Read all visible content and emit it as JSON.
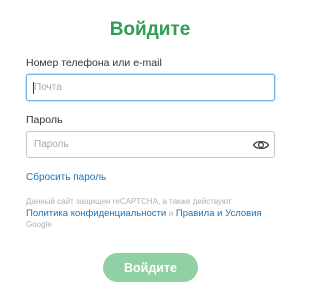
{
  "title": "Войдите",
  "login": {
    "label": "Номер телефона или e-mail",
    "placeholder": "Почта",
    "value": ""
  },
  "password": {
    "label": "Пароль",
    "placeholder": "Пароль",
    "value": "",
    "toggle_icon": "eye-icon"
  },
  "forgot_link": "Сбросить пароль",
  "captcha": {
    "text_before": "Данный сайт защищен reCAPTCHA, а также действуют",
    "privacy_link": "Политика конфиденциальности",
    "and_text": "и",
    "terms_link": "Правила и Условия",
    "text_after": "Google"
  },
  "submit_label": "Войдите",
  "colors": {
    "title": "#2f9b54",
    "link": "#1a73b8",
    "button_bg": "#8fd0a4",
    "focus_border": "#6fb3e8"
  }
}
